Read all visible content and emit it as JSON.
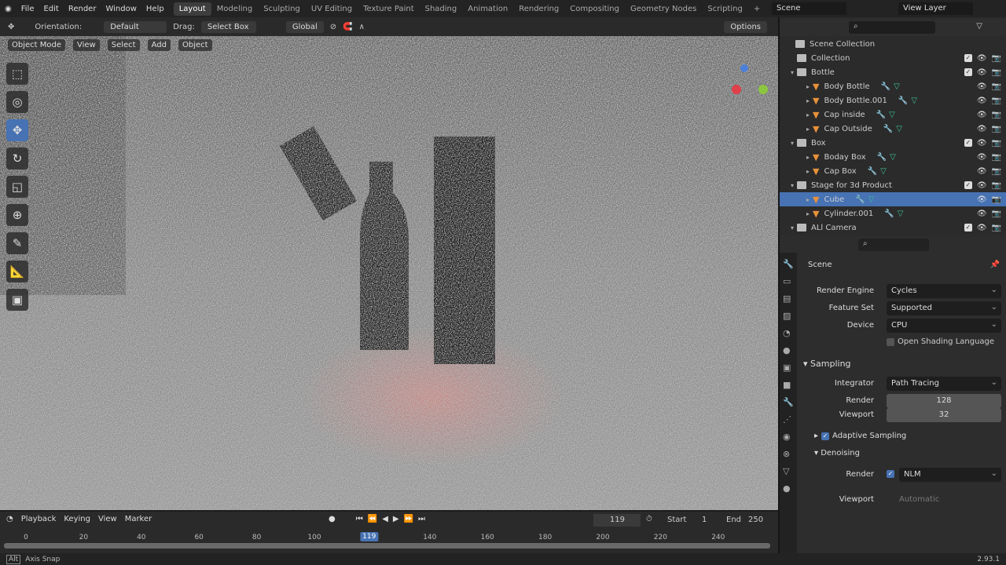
{
  "menu": [
    "File",
    "Edit",
    "Render",
    "Window",
    "Help"
  ],
  "workspaces": [
    "Layout",
    "Modeling",
    "Sculpting",
    "UV Editing",
    "Texture Paint",
    "Shading",
    "Animation",
    "Rendering",
    "Compositing",
    "Geometry Nodes",
    "Scripting"
  ],
  "active_workspace": "Layout",
  "scene": "Scene",
  "view_layer": "View Layer",
  "header": {
    "orientation_label": "Orientation:",
    "orientation": "Default",
    "drag_label": "Drag:",
    "drag": "Select Box",
    "transform": "Global",
    "options": "Options"
  },
  "viewport_header": {
    "mode": "Object Mode",
    "view": "View",
    "select": "Select",
    "add": "Add",
    "object": "Object"
  },
  "outliner": {
    "root": "Scene Collection",
    "items": [
      {
        "name": "Collection",
        "type": "collection",
        "level": 1
      },
      {
        "name": "Bottle",
        "type": "collection",
        "level": 1
      },
      {
        "name": "Body Bottle",
        "type": "object",
        "level": 2
      },
      {
        "name": "Body Bottle.001",
        "type": "object",
        "level": 2
      },
      {
        "name": "Cap inside",
        "type": "object",
        "level": 2
      },
      {
        "name": "Cap Outside",
        "type": "object",
        "level": 2
      },
      {
        "name": "Box",
        "type": "collection",
        "level": 1
      },
      {
        "name": "Boday Box",
        "type": "object",
        "level": 2
      },
      {
        "name": "Cap Box",
        "type": "object",
        "level": 2
      },
      {
        "name": "Stage for 3d Product",
        "type": "collection",
        "level": 1
      },
      {
        "name": "Cube",
        "type": "object",
        "level": 2,
        "selected": true
      },
      {
        "name": "Cylinder.001",
        "type": "object",
        "level": 2
      },
      {
        "name": "ALl Camera",
        "type": "collection",
        "level": 1
      }
    ]
  },
  "properties": {
    "context": "Scene",
    "render_engine_label": "Render Engine",
    "render_engine": "Cycles",
    "feature_set_label": "Feature Set",
    "feature_set": "Supported",
    "device_label": "Device",
    "device": "CPU",
    "osl": "Open Shading Language",
    "sampling": "Sampling",
    "integrator_label": "Integrator",
    "integrator": "Path Tracing",
    "render_label": "Render",
    "render_samples": "128",
    "viewport_label": "Viewport",
    "viewport_samples": "32",
    "adaptive": "Adaptive Sampling",
    "denoising": "Denoising",
    "denoise_render_label": "Render",
    "denoiser": "NLM",
    "denoise_viewport_label": "Viewport",
    "denoise_viewport": "Automatic"
  },
  "timeline": {
    "playback": "Playback",
    "keying": "Keying",
    "view": "View",
    "marker": "Marker",
    "current_frame": "119",
    "start_label": "Start",
    "start": "1",
    "end_label": "End",
    "end": "250",
    "ticks": [
      "0",
      "20",
      "40",
      "60",
      "80",
      "100",
      "119",
      "140",
      "160",
      "180",
      "200",
      "220",
      "240"
    ]
  },
  "status": {
    "key": "Alt",
    "text": "Axis Snap",
    "version": "2.93.1"
  },
  "colors": {
    "accent": "#4772b3",
    "object": "#e8913a",
    "mesh": "#3cc09a"
  }
}
